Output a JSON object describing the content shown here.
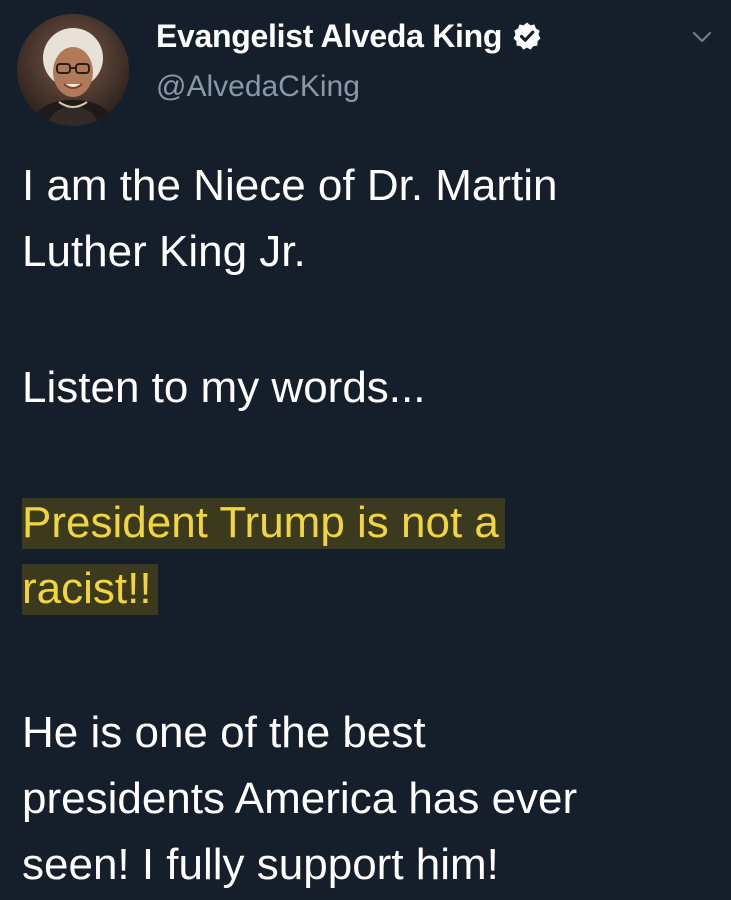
{
  "tweet": {
    "display_name": "Evangelist Alveda King",
    "handle": "@AlvedaCKing",
    "icons": {
      "verified": "verified-badge-icon",
      "menu": "chevron-down-icon"
    },
    "colors": {
      "background": "#15202b",
      "text": "#ffffff",
      "secondary_text": "#8899a6",
      "highlight_text": "#f2d43e"
    },
    "paragraphs": [
      {
        "lines": [
          "I am the Niece of Dr. Martin",
          "Luther King Jr."
        ]
      },
      {
        "lines": [
          "Listen to my words..."
        ]
      },
      {
        "lines": [
          "President Trump is not a",
          "racist!!"
        ],
        "highlighted": true
      },
      {
        "lines": [
          "He is one of the best",
          "presidents America has ever",
          "seen! I fully support him!"
        ]
      }
    ]
  }
}
